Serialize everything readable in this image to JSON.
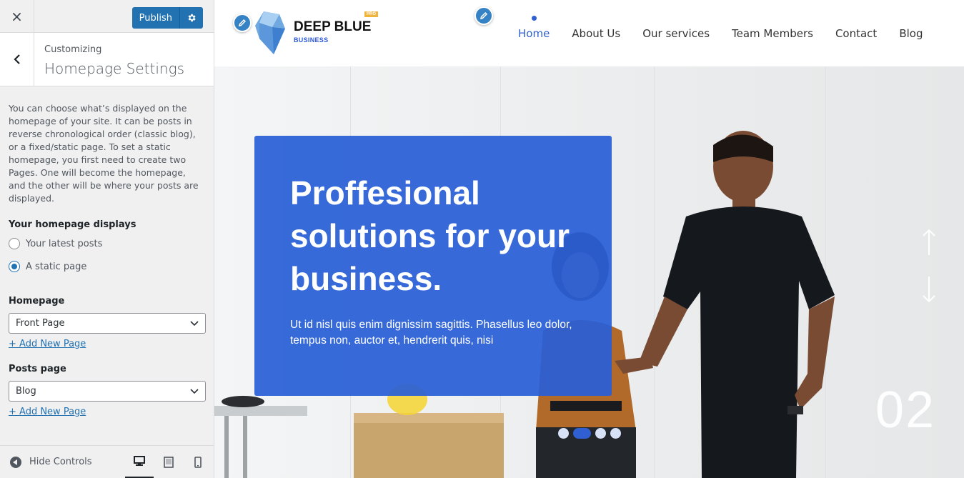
{
  "customizer": {
    "close_label": "×",
    "publish_label": "Publish",
    "crumb": "Customizing",
    "section_title": "Homepage Settings",
    "description": "You can choose what’s displayed on the homepage of your site. It can be posts in reverse chronological order (classic blog), or a fixed/static page. To set a static homepage, you first need to create two Pages. One will become the homepage, and the other will be where your posts are displayed.",
    "displays_label": "Your homepage displays",
    "radio_options": [
      {
        "label": "Your latest posts",
        "checked": false
      },
      {
        "label": "A static page",
        "checked": true
      }
    ],
    "homepage_label": "Homepage",
    "homepage_value": "Front Page",
    "posts_page_label": "Posts page",
    "posts_page_value": "Blog",
    "add_new_page": "+ Add New Page",
    "hide_controls": "Hide Controls"
  },
  "site": {
    "brand_name": "DEEP BLUE",
    "brand_sub": "BUSINESS",
    "pro_badge": "PRO",
    "nav": [
      "Home",
      "About Us",
      "Our services",
      "Team Members",
      "Contact",
      "Blog"
    ],
    "active_nav": "Home",
    "hero_title": "Proffesional solutions for your business.",
    "hero_text": "Ut id nisl quis enim dignissim sagittis. Phasellus leo dolor, tempus non, auctor et, hendrerit quis, nisi",
    "slide_number": "02",
    "slider_dots": 4,
    "active_dot": 2
  },
  "colors": {
    "wp_blue": "#2271b1",
    "brand_blue": "#2f5fd0",
    "sidebar_bg": "#f0f0f1"
  }
}
